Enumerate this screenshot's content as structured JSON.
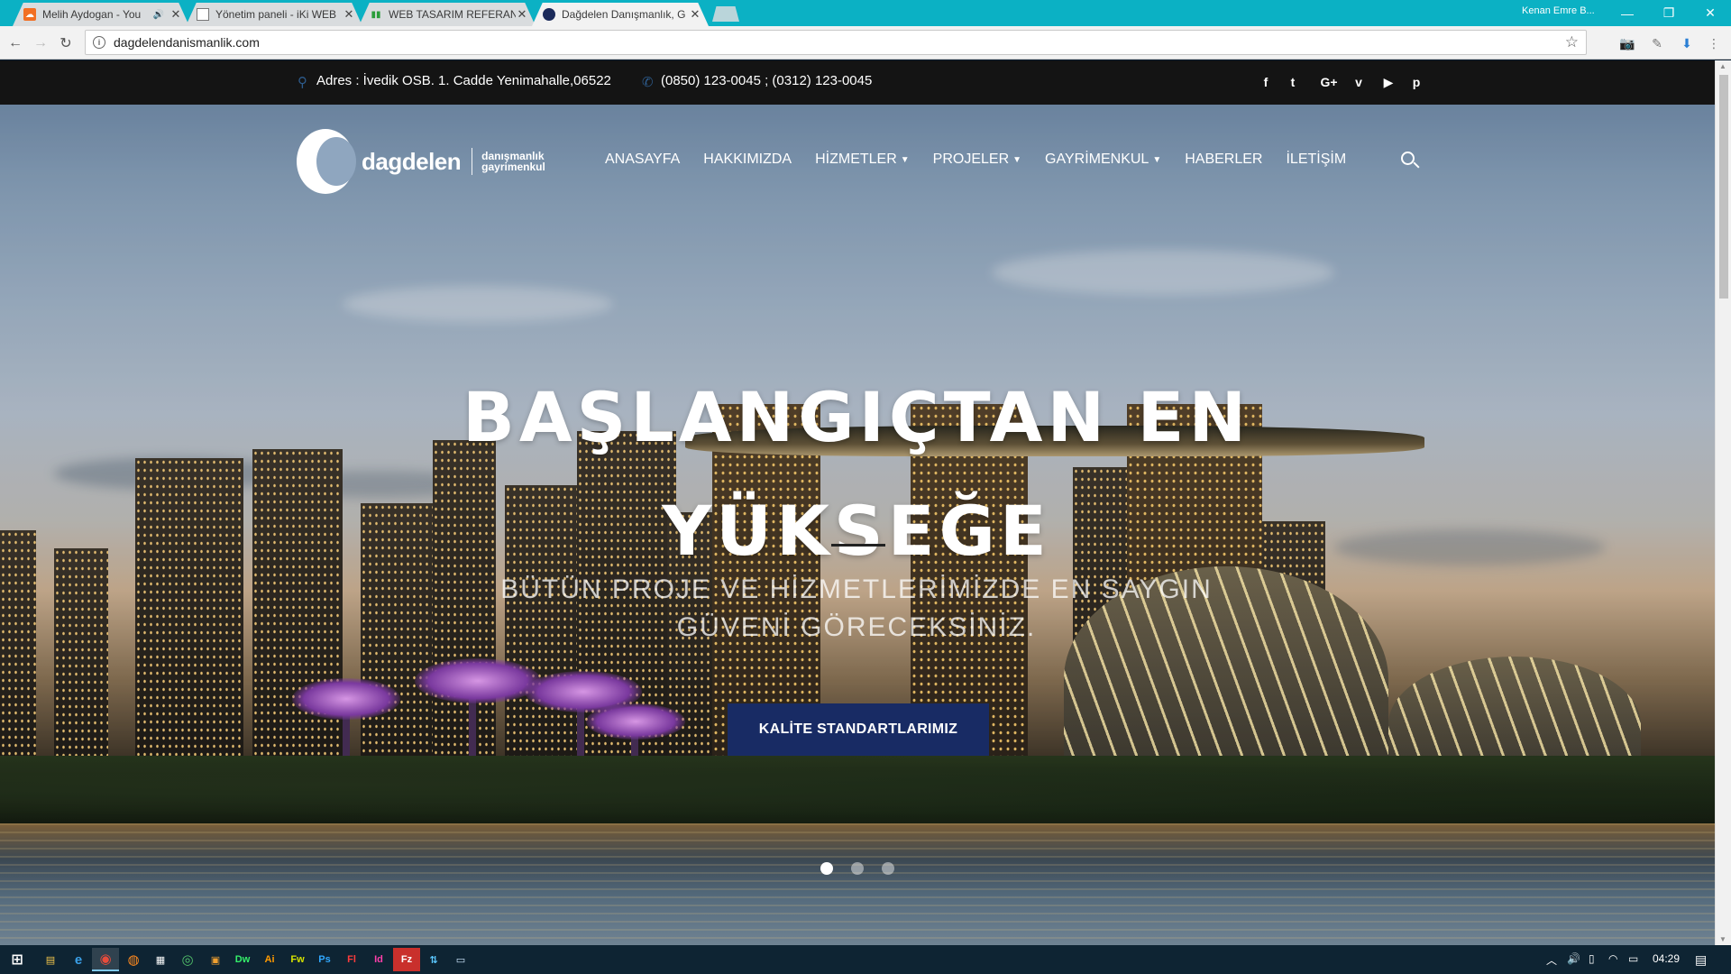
{
  "browser": {
    "tabs": [
      {
        "title": "Melih Aydogan - You",
        "icon": "soundcloud-icon"
      },
      {
        "title": "Yönetim paneli - iKi WEB",
        "icon": "page-icon"
      },
      {
        "title": "WEB TASARIM REFERANS",
        "icon": "chart-icon"
      },
      {
        "title": "Dağdelen Danışmanlık, G",
        "icon": "dagdelen-favicon"
      }
    ],
    "profile": "Kenan Emre B...",
    "url": "dagdelendanismanlik.com"
  },
  "colors": {
    "tabstrip": "#0bb1c4",
    "infobar": "#141414",
    "cta": "#182b64",
    "pin": "#2d5b8c",
    "taskbar": "#0e2433"
  },
  "topbar": {
    "address": "Adres : İvedik OSB. 1. Cadde Yenimahalle,06522",
    "phone": "(0850) 123-0045 ; (0312) 123-0045",
    "social": [
      {
        "name": "facebook-icon",
        "glyph": "f"
      },
      {
        "name": "twitter-icon",
        "glyph": "🐦"
      },
      {
        "name": "google-plus-icon",
        "glyph": "G+"
      },
      {
        "name": "vimeo-icon",
        "glyph": "V"
      },
      {
        "name": "youtube-icon",
        "glyph": "▶"
      },
      {
        "name": "pinterest-icon",
        "glyph": "P"
      }
    ]
  },
  "logo": {
    "word": "dagdelen",
    "sub1": "danışmanlık",
    "sub2": "gayrimenkul"
  },
  "nav": {
    "home": "ANASAYFA",
    "about": "HAKKIMIZDA",
    "services": "HİZMETLER",
    "projects": "PROJELER",
    "realestate": "GAYRİMENKUL",
    "news": "HABERLER",
    "contact": "İLETİŞİM"
  },
  "hero": {
    "headline_line1": "BAŞLANGIÇTAN EN",
    "headline_line2": "YÜKSEĞE",
    "subline_line1": "BÜTÜN PROJE VE HİZMETLERİMİZDE EN SAYGIN",
    "subline_line2": "GÜVENİ GÖRECEKSİNİZ.",
    "cta": "KALİTE STANDARTLARIMIZ",
    "slides": 3,
    "active_slide": 1
  },
  "taskbar": {
    "clock": "04:29"
  }
}
